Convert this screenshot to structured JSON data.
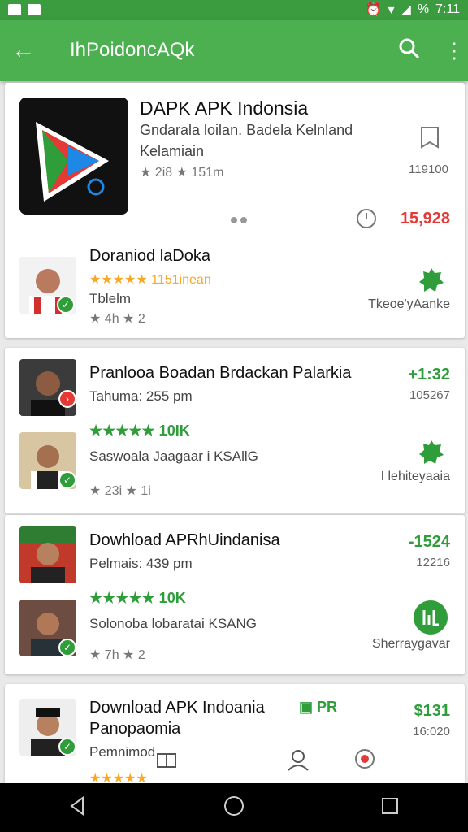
{
  "status": {
    "battery": "%",
    "time": "7:11"
  },
  "appbar": {
    "title": "IhPoidoncAQk"
  },
  "featured": {
    "title": "DAPK APK Indonsia",
    "subtitle1": "Gndarala loilan. Badela Kelnland",
    "subtitle2": "Kelamiain",
    "meta": "★ 2i8 ★ 151m",
    "side_num": "119100",
    "price": "15,928",
    "colors": {
      "accent": "#e53935"
    }
  },
  "row1": {
    "title": "Doraniod laDoka",
    "rating_text": "★★★★★ 1151inean",
    "line2": "Tblelm",
    "meta": "★ 4h ★ 2",
    "action": "Tkeoe'yAanke"
  },
  "card2": {
    "title": "Pranlooa Boadan Brdackan Palarkia",
    "line2": "Tahuma: 255 pm",
    "price": "+1:32",
    "num": "105267",
    "rating": "★★★★★ 10IK",
    "line3": "Saswoala Jaagaar i KSAllG",
    "meta": "★ 23i ★ 1i",
    "action": "I lehiteyaaia"
  },
  "card3": {
    "title": "Dowhload APRhUindanisa",
    "line2": "Pelmais: 439 pm",
    "price": "-1524",
    "num": "12216",
    "rating": "★★★★★ 10K",
    "line3": "Solonoba lobaratai KSANG",
    "meta": "★ 7h ★ 2",
    "action": "Sherraygavar"
  },
  "card4": {
    "title": "Download APK Indoania",
    "tag": "PR",
    "title2": "Panopaomia",
    "line2": "Pemnimod",
    "price": "$131",
    "num": "16:020"
  }
}
